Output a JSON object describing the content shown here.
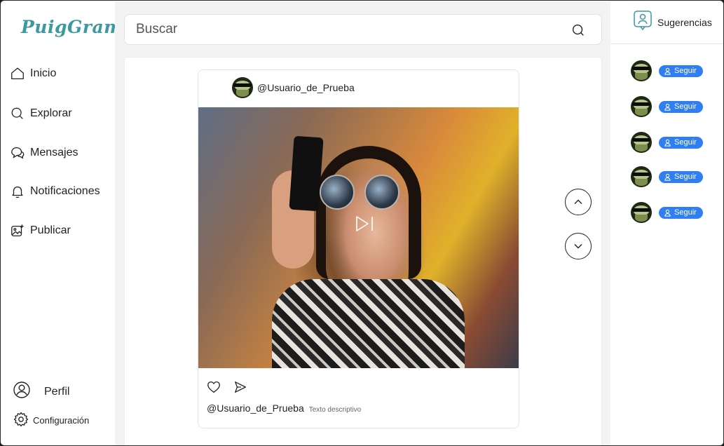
{
  "app": {
    "logo": "PuigGram"
  },
  "sidebar": {
    "items": [
      {
        "label": "Inicio",
        "icon": "home-icon"
      },
      {
        "label": "Explorar",
        "icon": "search-icon"
      },
      {
        "label": "Mensajes",
        "icon": "chat-bubbles-icon"
      },
      {
        "label": "Notificaciones",
        "icon": "bell-icon"
      },
      {
        "label": "Publicar",
        "icon": "add-photo-icon"
      }
    ],
    "profile_label": "Perfil",
    "settings_label": "Configuración"
  },
  "search": {
    "placeholder": "Buscar"
  },
  "post": {
    "username": "@Usuario_de_Prueba",
    "caption_user": "@Usuario_de_Prueba",
    "caption_text": "Texto descriptivo",
    "media_type": "video"
  },
  "suggestions": {
    "title": "Sugerencias",
    "follow_label": "Seguir",
    "count": 5,
    "items": [
      {
        "button": "Seguir"
      },
      {
        "button": "Seguir"
      },
      {
        "button": "Seguir"
      },
      {
        "button": "Seguir"
      },
      {
        "button": "Seguir"
      }
    ]
  },
  "colors": {
    "brand": "#3a9aa0",
    "accent": "#2f7ff2",
    "background": "#f3f3f3"
  }
}
